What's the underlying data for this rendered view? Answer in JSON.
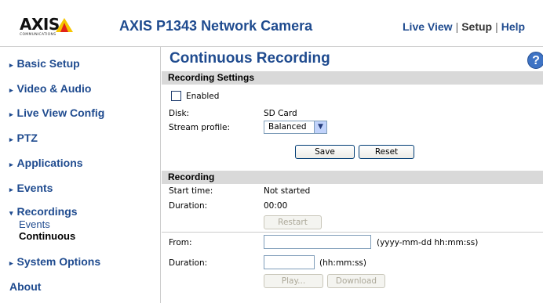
{
  "header": {
    "logo_text": "AXIS",
    "logo_sub": "COMMUNICATIONS",
    "title": "AXIS P1343 Network Camera",
    "links": [
      "Live View",
      "Setup",
      "Help"
    ],
    "separator": "|"
  },
  "sidebar": {
    "items": [
      {
        "label": "Basic Setup"
      },
      {
        "label": "Video & Audio"
      },
      {
        "label": "Live View Config"
      },
      {
        "label": "PTZ"
      },
      {
        "label": "Applications"
      },
      {
        "label": "Events"
      },
      {
        "label": "Recordings"
      },
      {
        "label": "System Options"
      },
      {
        "label": "About"
      }
    ],
    "sub_items": [
      {
        "label": "Events"
      },
      {
        "label": "Continuous"
      }
    ]
  },
  "main": {
    "title": "Continuous Recording",
    "help_icon": "?",
    "settings": {
      "heading": "Recording Settings",
      "enabled_label": "Enabled",
      "disk_label": "Disk:",
      "disk_value": "SD Card",
      "stream_label": "Stream profile:",
      "stream_value": "Balanced",
      "save_label": "Save",
      "reset_label": "Reset"
    },
    "recording": {
      "heading": "Recording",
      "start_label": "Start time:",
      "start_value": "Not started",
      "duration_label": "Duration:",
      "duration_value": "00:00",
      "restart_label": "Restart",
      "from_label": "From:",
      "from_hint": "(yyyy-mm-dd hh:mm:ss)",
      "duration2_label": "Duration:",
      "duration2_hint": "(hh:mm:ss)",
      "play_label": "Play...",
      "download_label": "Download"
    }
  },
  "icons": {
    "nav_arrow": "▸",
    "nav_arrow_open": "▾",
    "dropdown": "▼"
  },
  "colors": {
    "link": "#1f4b8f",
    "section_bg": "#d9d9d9",
    "help_bg": "#3e73c4"
  }
}
